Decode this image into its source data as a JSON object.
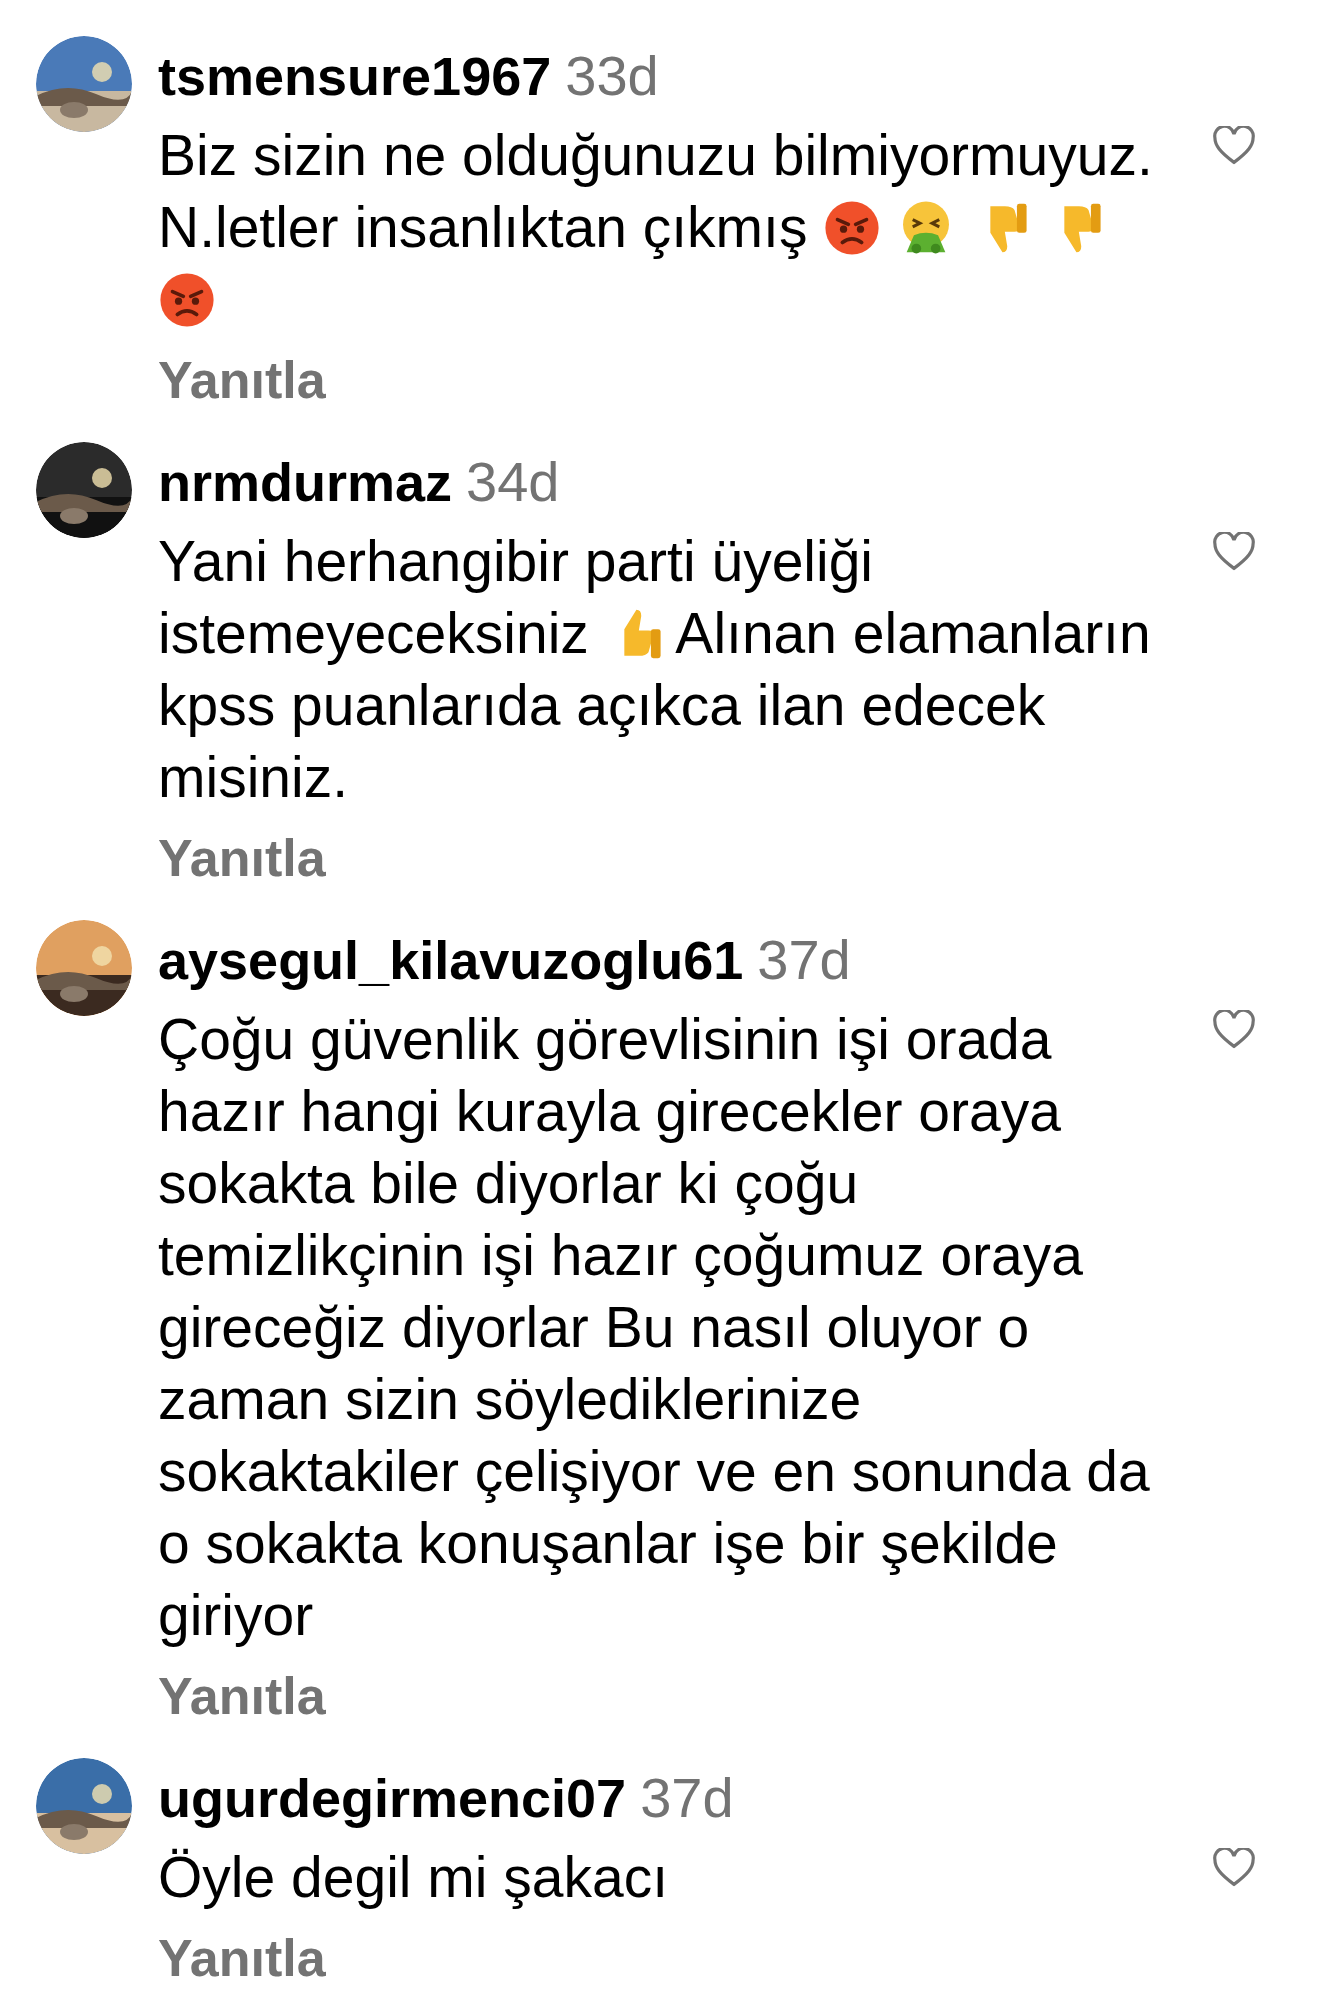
{
  "comments": [
    {
      "username": "tsmensure1967",
      "time": "33d",
      "liked": false,
      "body": [
        {
          "kind": "text",
          "text": "Biz sizin ne olduğunuzu bilmiyormuyuz. N.letler insanlıktan çıkmış"
        },
        {
          "kind": "angry"
        },
        {
          "kind": "vomit"
        },
        {
          "kind": "thumbs-down"
        },
        {
          "kind": "thumbs-down"
        },
        {
          "kind": "angry"
        }
      ],
      "reply": "Yanıtla"
    },
    {
      "username": "nrmdurmaz",
      "time": "34d",
      "liked": false,
      "body": [
        {
          "kind": "text",
          "text": "Yani herhangibir parti üyeliği istemeyeceksiniz"
        },
        {
          "kind": "thumbs-up"
        },
        {
          "kind": "text",
          "text": "Alınan elamanların kpss puanlarıda açıkca ilan edecek misiniz."
        }
      ],
      "reply": "Yanıtla"
    },
    {
      "username": "aysegul_kilavuzoglu61",
      "time": "37d",
      "liked": false,
      "body": [
        {
          "kind": "text",
          "text": "Çoğu güvenlik görevlisinin işi orada hazır hangi kurayla girecekler oraya sokakta bile diyorlar ki çoğu temizlikçinin işi hazır çoğumuz oraya gireceğiz diyorlar Bu nasıl oluyor o zaman sizin söylediklerinize sokaktakiler çelişiyor ve en sonunda da o sokakta konuşanlar işe bir şekilde giriyor"
        }
      ],
      "reply": "Yanıtla"
    },
    {
      "username": "ugurdegirmenci07",
      "time": "37d",
      "liked": false,
      "body": [
        {
          "kind": "text",
          "text": "Öyle degil mi şakacı"
        }
      ],
      "reply": "Yanıtla"
    }
  ]
}
